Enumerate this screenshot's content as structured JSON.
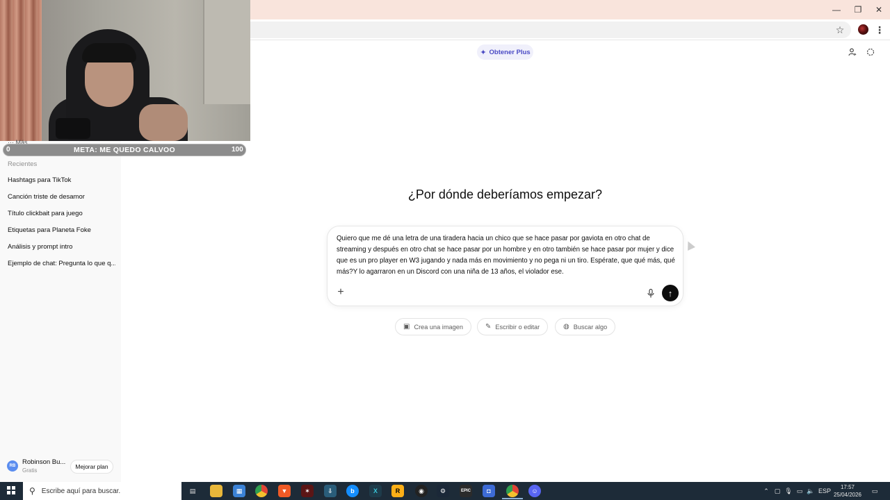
{
  "browser": {
    "window_controls": {
      "minimize": "—",
      "restore": "❐",
      "close": "✕"
    },
    "icons": {
      "bookmark": "star-icon",
      "menu": "kebab-menu-icon"
    }
  },
  "webcam_overlay": {
    "goal_bar": {
      "left_value": "0",
      "label": "META: ME QUEDO CALVOO",
      "right_value": "100",
      "progress": 0
    },
    "peek_text": "··· Más"
  },
  "sidebar": {
    "recents_heading": "Recientes",
    "recents": [
      {
        "label": "Hashtags para TikTok"
      },
      {
        "label": "Canción triste de desamor"
      },
      {
        "label": "Título clickbait para juego"
      },
      {
        "label": "Etiquetas para Planeta Foke"
      },
      {
        "label": "Análisis y prompt intro"
      },
      {
        "label": "Ejemplo de chat: Pregunta lo que q..."
      }
    ],
    "user": {
      "initials": "RB",
      "name": "Robinson Bu...",
      "plan": "Gratis",
      "upgrade_label": "Mejorar plan"
    }
  },
  "main": {
    "plus_pill": {
      "icon": "sparkle-icon",
      "label": "Obtener Plus"
    },
    "top_right_icons": [
      "user-icon",
      "temporary-chat-icon"
    ],
    "heading": "¿Por dónde deberíamos empezar?",
    "composer": {
      "text": "Quiero que me dé una letra de una tiradera hacia un chico que se hace pasar por gaviota en otro chat de streaming y después en otro chat se hace pasar por un hombre y en otro también se hace pasar por mujer y dice que es un pro player en W3 jugando y nada más en movimiento y no pega ni un tiro. Espérate, que qué más, qué más?Y lo agarraron en un Discord con una niña de 13 años, el violador ese.",
      "plus_icon": "plus-icon",
      "mic_icon": "microphone-icon",
      "send_icon": "arrow-up-icon"
    },
    "chips": [
      {
        "icon": "image-icon",
        "label": "Crea una imagen"
      },
      {
        "icon": "pencil-icon",
        "label": "Escribir o editar"
      },
      {
        "icon": "globe-icon",
        "label": "Buscar algo"
      }
    ]
  },
  "taskbar": {
    "search_placeholder": "Escribe aquí para buscar.",
    "apps": [
      "task-view-icon",
      "file-explorer-icon",
      "store-icon",
      "chrome-icon",
      "brave-icon",
      "game-icon",
      "app-icon",
      "battlenet-icon",
      "xsplit-icon",
      "rockstar-icon",
      "obs-icon",
      "steam-icon",
      "epic-games-icon",
      "app-icon",
      "chrome-icon",
      "discord-icon"
    ],
    "language": "ESP",
    "time": "17:57",
    "date": "25/04/2026"
  }
}
